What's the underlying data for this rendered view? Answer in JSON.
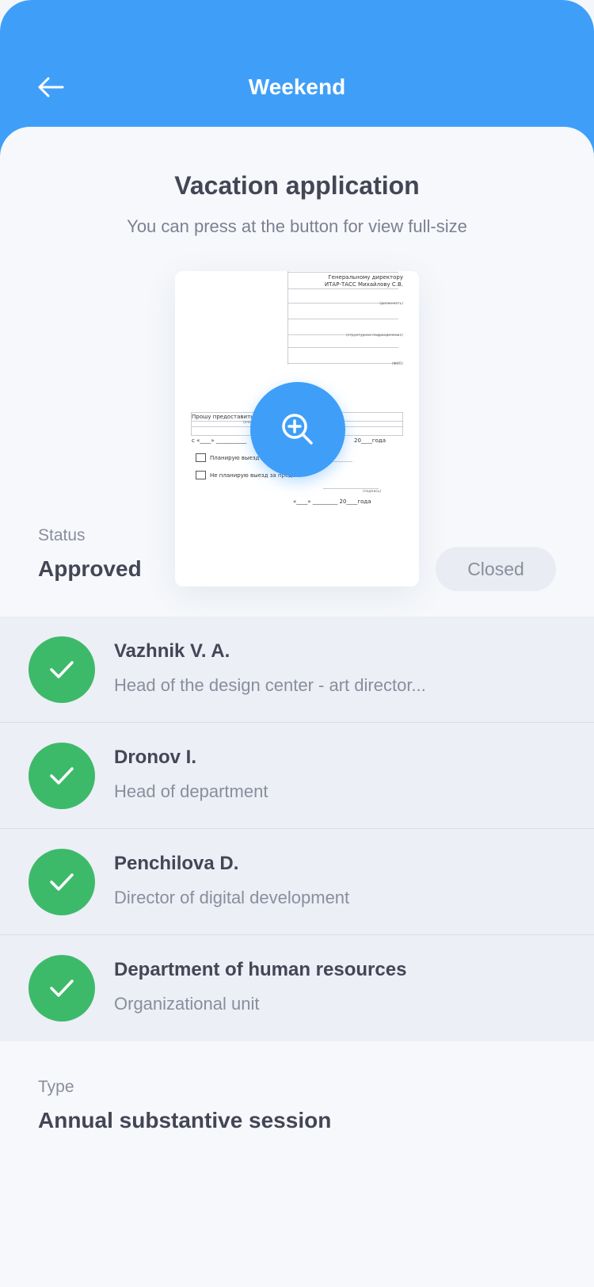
{
  "header": {
    "title": "Weekend",
    "back_icon": "arrow-left-icon",
    "color": "#3f9ff8"
  },
  "document": {
    "title": "Vacation application",
    "subtitle": "You can press at the button for view full-size",
    "zoom_icon": "zoom-in-icon",
    "preview": {
      "addressee_line1": "Генеральному директору",
      "addressee_line2": "ИТАР-ТАСС Михайлову С.В.",
      "label_position": "(должность)",
      "label_unit": "(структурное подразделение)",
      "label_name": "(ФИО)",
      "request_text": "Прошу предоставить с",
      "leave_type_hint": "(очередной оплачиваемый, учебный)",
      "date_from": "с «____» ___________",
      "year_suffix": "20____года",
      "option_plan": "Планирую выезд за",
      "option_no_plan": "Не планирую выезд за предел",
      "signature_label": "(подпись)",
      "date_sign": "«____» _________ 20____года"
    }
  },
  "status": {
    "label": "Status",
    "value": "Approved",
    "badge": "Closed"
  },
  "approvers": [
    {
      "name": "Vazhnik V. A.",
      "role": "Head of the design center - art director...",
      "icon": "check-icon"
    },
    {
      "name": "Dronov I.",
      "role": "Head of department",
      "icon": "check-icon"
    },
    {
      "name": "Penchilova D.",
      "role": "Director of digital development",
      "icon": "check-icon"
    },
    {
      "name": "Department of human resources",
      "role": "Organizational unit",
      "icon": "check-icon"
    }
  ],
  "approved_color": "#3dba69",
  "type": {
    "label": "Type",
    "value": "Annual substantive session"
  }
}
